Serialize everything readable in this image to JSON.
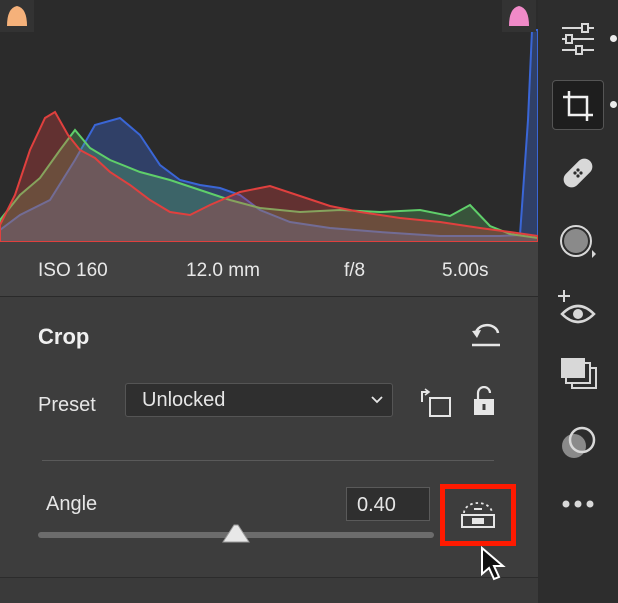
{
  "histogram": {
    "shadow_clipping_color": "#f5b17a",
    "highlight_clipping_color": "#f08ac8",
    "channel_colors": {
      "red": "#e0403e",
      "green": "#5fcf6a",
      "blue": "#3a66d6"
    }
  },
  "exif": {
    "iso": "ISO 160",
    "focal_length": "12.0 mm",
    "aperture": "f/8",
    "shutter": "5.00s"
  },
  "crop_panel": {
    "title": "Crop",
    "preset_label": "Preset",
    "preset_value": "Unlocked",
    "angle_label": "Angle",
    "angle_value": "0.40",
    "angle_slider_position": 0.5
  },
  "highlight_color": "#ff1a00",
  "toolbar": {
    "tools": [
      "edit-sliders-icon",
      "crop-icon",
      "healing-bandage-icon",
      "masking-icon",
      "red-eye-icon",
      "presets-icon",
      "snapshots-icon",
      "more-icon"
    ],
    "active_tool": "crop-icon"
  }
}
